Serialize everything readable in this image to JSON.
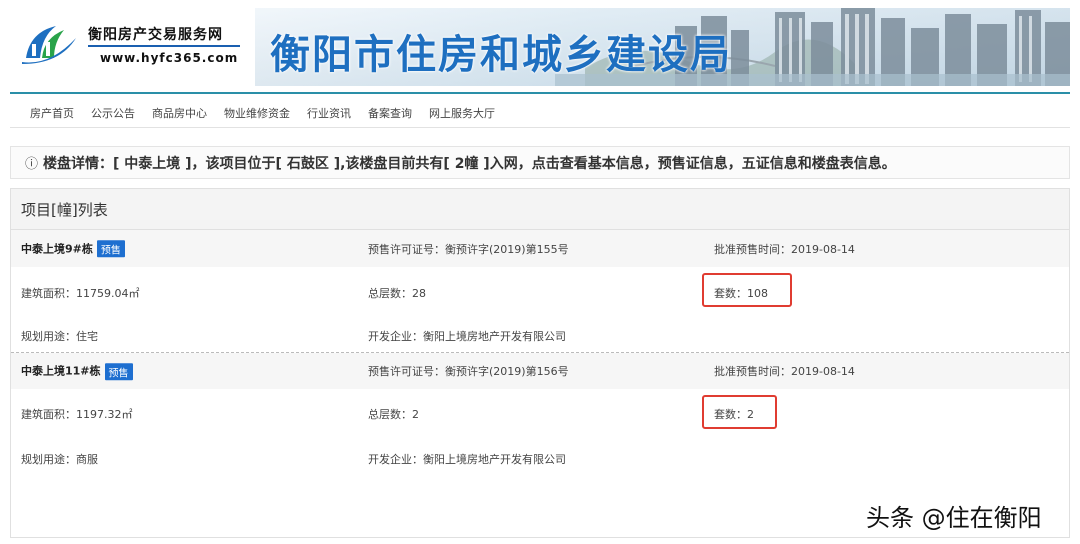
{
  "header": {
    "site_name": "衡阳房产交易服务网",
    "site_url": "www.hyfc365.com",
    "bureau_title": "衡阳市住房和城乡建设局",
    "logo_icon": "house-wave-logo"
  },
  "nav": {
    "items": [
      "房产首页",
      "公示公告",
      "商品房中心",
      "物业维修资金",
      "行业资讯",
      "备案查询",
      "网上服务大厅"
    ]
  },
  "notice": {
    "icon": "info-circle-icon",
    "icon_glyph": "ⓘ",
    "text": "楼盘详情：[ 中泰上境 ]，该项目位于[ 石鼓区 ],该楼盘目前共有[ 2幢 ]入网，点击查看基本信息，预售证信息，五证信息和楼盘表信息。"
  },
  "project_list": {
    "title": "项目[幢]列表",
    "buildings": [
      {
        "name": "中泰上境9#栋",
        "badge": "预售",
        "permit": "预售许可证号：衡预许字(2019)第155号",
        "approve_date": "批准预售时间：2019-08-14",
        "area": "建筑面积：11759.04㎡",
        "floors": "总层数：28",
        "units": "套数：108",
        "usage": "规划用途：住宅",
        "developer": "开发企业：衡阳上境房地产开发有限公司"
      },
      {
        "name": "中泰上境11#栋",
        "badge": "预售",
        "permit": "预售许可证号：衡预许字(2019)第156号",
        "approve_date": "批准预售时间：2019-08-14",
        "area": "建筑面积：1197.32㎡",
        "floors": "总层数：2",
        "units": "套数：2",
        "usage": "规划用途：商服",
        "developer": "开发企业：衡阳上境房地产开发有限公司"
      }
    ]
  },
  "watermark": "头条 @住在衡阳",
  "colors": {
    "brand_blue": "#1e6fc0",
    "badge_blue": "#1e6fd0",
    "highlight_red": "#e03c31",
    "rule_teal": "#2a8fa8"
  }
}
